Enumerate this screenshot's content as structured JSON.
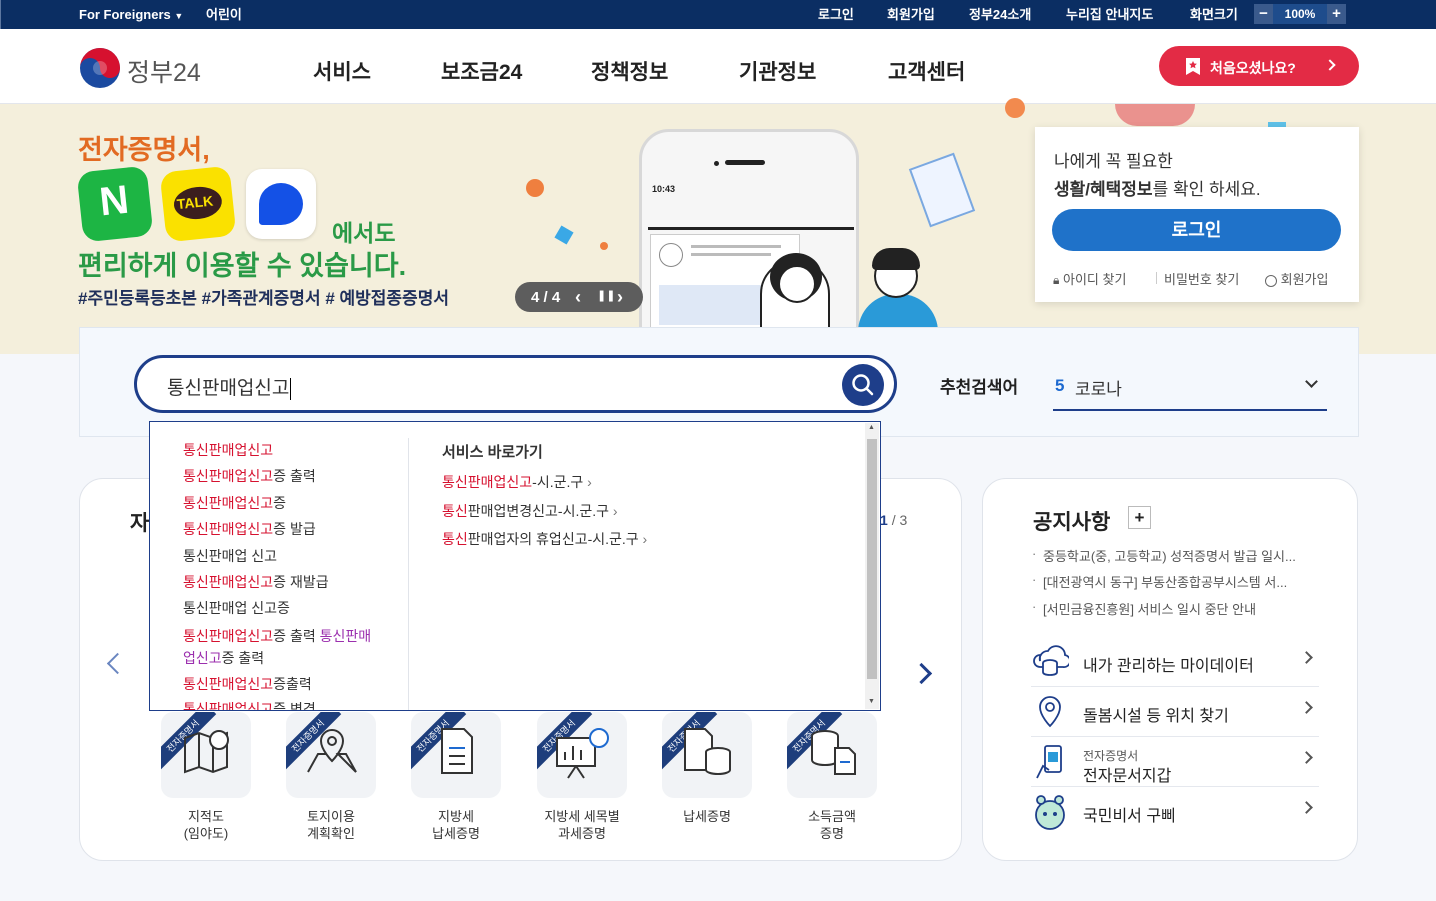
{
  "util": {
    "for_foreigners": "For Foreigners",
    "kids": "어린이",
    "login": "로그인",
    "signup": "회원가입",
    "about": "정부24소개",
    "sitemap": "누리집 안내지도",
    "screen_size": "화면크기",
    "zoom_minus": "−",
    "zoom_value": "100%",
    "zoom_plus": "+"
  },
  "header": {
    "logo": "정부24",
    "nav": [
      "서비스",
      "보조금24",
      "정책정보",
      "기관정보",
      "고객센터"
    ],
    "first_visit": "처음오셨나요?"
  },
  "banner": {
    "line1": "전자증명서,",
    "line_apps": "에서도",
    "line2": "편리하게 이용할 수 있습니다.",
    "tags": "#주민등록등초본  #가족관계증명서  # 예방접종증명서",
    "app_n": "N",
    "app_talk": "TALK",
    "pager": "4 / 4",
    "phone_time": "10:43"
  },
  "login_box": {
    "line1": "나에게 꼭 필요한",
    "line2_bold": "생활/혜택정보",
    "line2_rest": "를 확인 하세요.",
    "login_button": "로그인",
    "find_id": "아이디 찾기",
    "find_pw": "비밀번호 찾기",
    "signup": "회원가입"
  },
  "search": {
    "value": "통신판매업신고",
    "recommend_label": "추천검색어",
    "recommend_rank": "5",
    "recommend_term": "코로나"
  },
  "suggestions": [
    {
      "hl": "통신판매업신고",
      "rest": ""
    },
    {
      "hl": "통신판매업신고",
      "rest": "증 출력"
    },
    {
      "hl": "통신판매업신고",
      "rest": "증"
    },
    {
      "hl": "통신판매업신고",
      "rest": "증 발급"
    },
    {
      "hl": "",
      "rest": "통신판매업 신고"
    },
    {
      "hl": "통신판매업신고",
      "rest": "증 재발급"
    },
    {
      "hl": "",
      "rest": "통신판매업 신고증"
    },
    {
      "hl": "통신판매업신고",
      "rest": "증 출력 ",
      "hl2": "통신판매",
      "line2_hl2": "업신고",
      "line2_rest": "증 출력"
    },
    {
      "hl": "통신판매업신고",
      "rest": "증출력"
    },
    {
      "hl": "통신판매업신고",
      "rest": "증 변경"
    }
  ],
  "quick": {
    "title": "서비스 바로가기",
    "items": [
      {
        "hl": "통신판매업신고",
        "rest": "-시.군.구"
      },
      {
        "hl": "통신",
        "rest": "판매업변경신고-시.군.구"
      },
      {
        "hl": "통신",
        "rest": "판매업자의 휴업신고-시.군.구"
      }
    ]
  },
  "services": {
    "title_partial": "자",
    "page_current": "1",
    "page_total": "/ 3",
    "badge": "전자증명서",
    "items": [
      {
        "line1": "지적도",
        "line2": "(임야도)"
      },
      {
        "line1": "토지이용",
        "line2": "계획확인"
      },
      {
        "line1": "지방세",
        "line2": "납세증명"
      },
      {
        "line1": "지방세 세목별",
        "line2": "과세증명"
      },
      {
        "line1": "납세증명",
        "line2": ""
      },
      {
        "line1": "소득금액",
        "line2": "증명"
      }
    ]
  },
  "notice": {
    "title": "공지사항",
    "more": "+",
    "items": [
      "중등학교(중, 고등학교) 성적증명서 발급 일시...",
      "[대전광역시 동구] 부동산종합공부시스템 서...",
      "[서민금융진흥원] 서비스 일시 중단 안내"
    ],
    "links": [
      {
        "label": "내가 관리하는 마이데이터",
        "sub": ""
      },
      {
        "label": "돌봄시설 등 위치 찾기",
        "sub": ""
      },
      {
        "label": "전자문서지갑",
        "sub": "전자증명서"
      },
      {
        "label": "국민비서 구삐",
        "sub": ""
      }
    ]
  },
  "colors": {
    "navy": "#0b2e63",
    "accent_red": "#e32b45",
    "login_blue": "#1f72c9",
    "search_border": "#1e3e8a",
    "highlight": "#d6112f"
  }
}
